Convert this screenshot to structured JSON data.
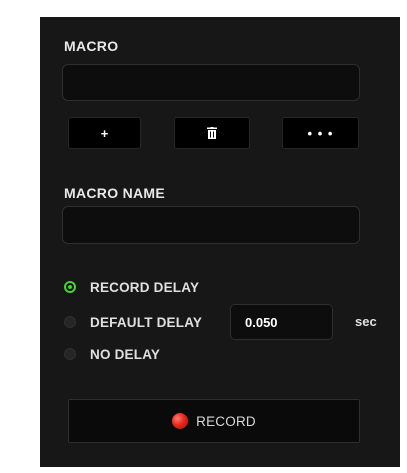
{
  "macro": {
    "label": "MACRO",
    "value": "",
    "add_button": "+",
    "more_button": "• • •"
  },
  "macro_name": {
    "label": "MACRO NAME",
    "value": ""
  },
  "delay": {
    "options": [
      {
        "label": "RECORD DELAY",
        "selected": true
      },
      {
        "label": "DEFAULT DELAY",
        "selected": false
      },
      {
        "label": "NO DELAY",
        "selected": false
      }
    ],
    "default_value": "0.050",
    "unit": "sec"
  },
  "record": {
    "label": "RECORD"
  },
  "colors": {
    "panel": "#171717",
    "accent": "#44d62c",
    "record": "#e8271b"
  },
  "icons": {
    "delete": "trash-icon",
    "record": "record-dot-icon"
  }
}
